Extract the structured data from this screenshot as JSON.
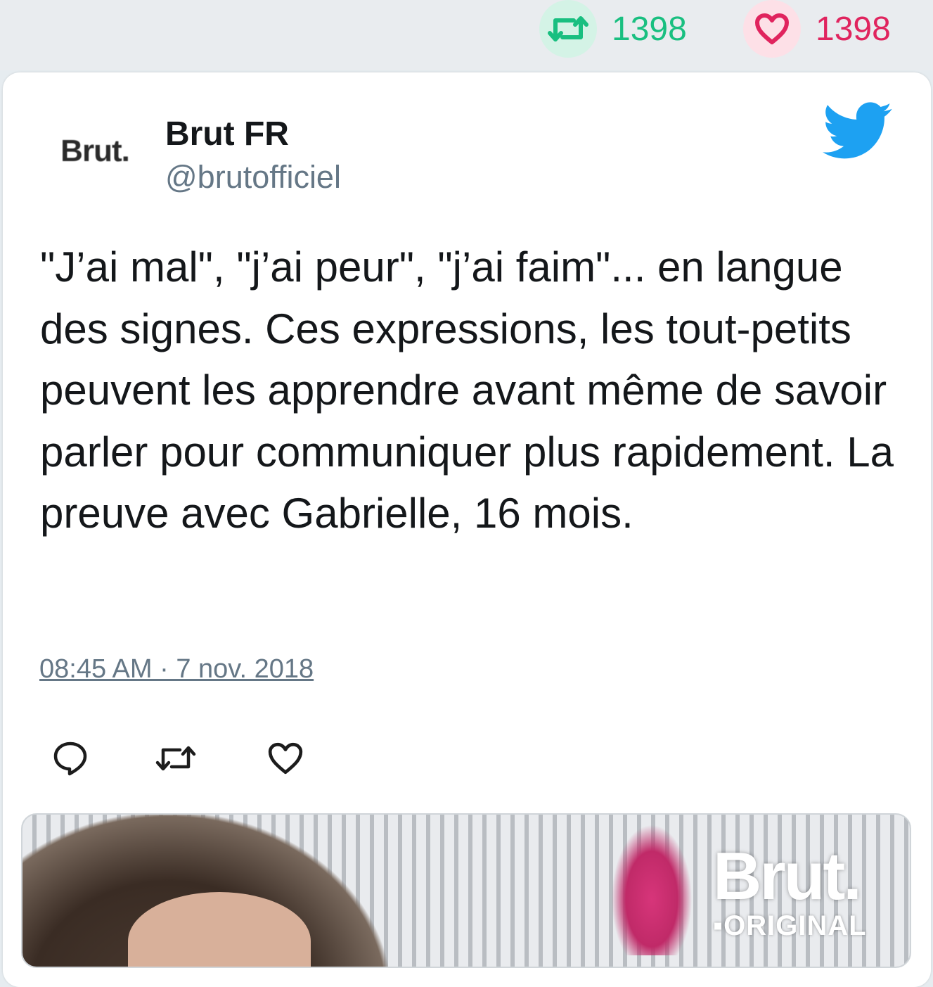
{
  "top_stats": {
    "retweet_count": "1398",
    "like_count": "1398",
    "retweet_icon": "retweet-icon",
    "like_icon": "heart-icon"
  },
  "tweet": {
    "display_name": "Brut FR",
    "handle": "@brutofficiel",
    "avatar_text": "Brut.",
    "text": "\"J’ai mal\", \"j’ai peur\", \"j’ai faim\"... en langue des signes. Ces expressions, les tout-petits peuvent les apprendre avant même de savoir parler pour communiquer plus rapidement. La preuve avec Gabrielle, 16 mois.",
    "timestamp": "08:45 AM · 7 nov. 2018"
  },
  "actions": {
    "reply_icon": "reply-icon",
    "retweet_icon": "retweet-icon",
    "like_icon": "heart-icon"
  },
  "media": {
    "logo_main": "Brut.",
    "logo_sub": "▪ORIGINAL"
  },
  "colors": {
    "retweet_green": "#19bf80",
    "like_red": "#e0245e",
    "twitter_blue": "#1da1f2",
    "muted_text": "#657786"
  }
}
